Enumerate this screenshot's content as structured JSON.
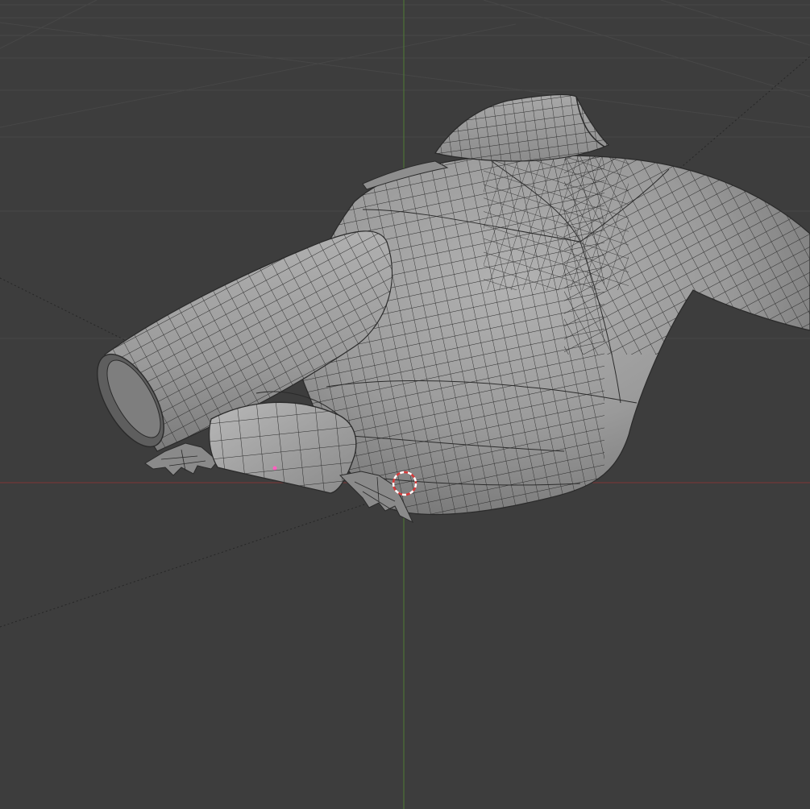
{
  "viewport": {
    "mode": "3D viewport",
    "shading": "solid",
    "overlays": {
      "wireframe": true,
      "floor_grid": true,
      "x_axis": true,
      "y_axis": true,
      "z_axis": true,
      "3d_cursor": true
    }
  },
  "colors": {
    "background": "#3d3d3d",
    "grid_line": "#4a4a4a",
    "x_axis": "#8a3a3a",
    "y_axis": "#4f7a34",
    "mesh_fill": "#9a9a9a",
    "mesh_highlight": "#b4b4b4",
    "mesh_shadow": "#6c6c6c",
    "wire": "#2a2a2a",
    "cursor_ring": "#d83a3a",
    "cursor_dash": "#ffffff"
  },
  "scene": {
    "objects": [
      {
        "name": "jacket",
        "icon": "mesh-icon"
      },
      {
        "name": "glove-cuff",
        "icon": "mesh-icon"
      },
      {
        "name": "left-hand-bat-wing",
        "icon": "mesh-icon"
      },
      {
        "name": "right-hand-bat-wing",
        "icon": "mesh-icon"
      }
    ]
  }
}
